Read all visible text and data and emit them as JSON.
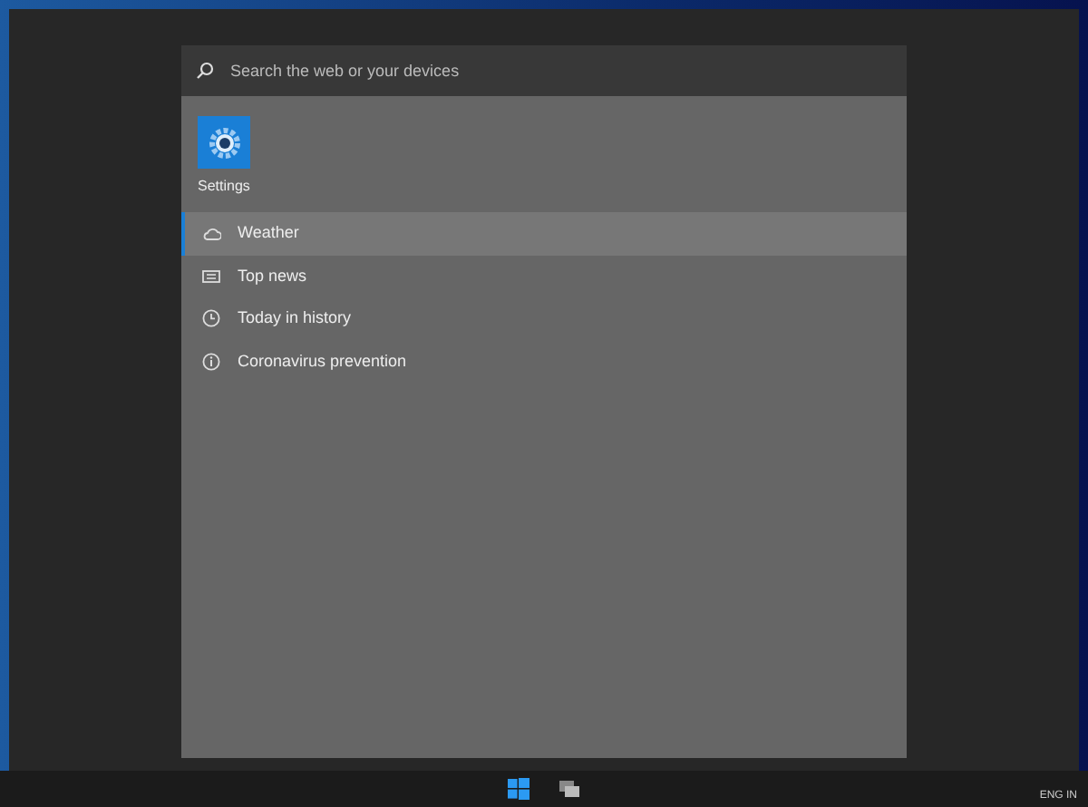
{
  "search": {
    "placeholder": "Search the web or your devices"
  },
  "top_app": {
    "label": "Settings"
  },
  "suggestions": [
    {
      "label": "Weather",
      "kind": "weather",
      "selected": true
    },
    {
      "label": "Top news",
      "kind": "news",
      "selected": false
    },
    {
      "label": "Today in history",
      "kind": "history",
      "selected": false
    },
    {
      "label": "Coronavirus prevention",
      "kind": "info",
      "selected": false
    }
  ],
  "tray": {
    "text": "ENG IN"
  }
}
